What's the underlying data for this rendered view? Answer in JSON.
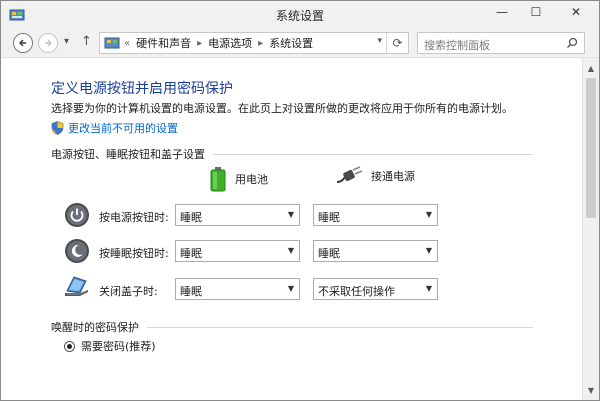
{
  "window": {
    "title": "系统设置",
    "controls": {
      "minimize": "—",
      "maximize": "☐",
      "close": "✕"
    }
  },
  "nav": {
    "back_icon": "back-arrow-icon",
    "forward_icon": "forward-arrow-icon",
    "recent_icon": "chevron-down-icon",
    "up_icon": "up-arrow-icon"
  },
  "address": {
    "overflow": "«",
    "crumbs": [
      "硬件和声音",
      "电源选项",
      "系统设置"
    ],
    "refresh_icon": "refresh-icon"
  },
  "search": {
    "placeholder": "搜索控制面板"
  },
  "page": {
    "title": "定义电源按钮并启用密码保护",
    "description": "选择要为你的计算机设置的电源设置。在此页上对设置所做的更改将应用于你所有的电源计划。",
    "change_link": "更改当前不可用的设置"
  },
  "section_power": {
    "heading": "电源按钮、睡眠按钮和盖子设置",
    "columns": {
      "battery": "用电池",
      "plugged": "接通电源"
    },
    "rows": [
      {
        "label": "按电源按钮时:",
        "battery": "睡眠",
        "plugged": "睡眠",
        "icon": "power-button-icon"
      },
      {
        "label": "按睡眠按钮时:",
        "battery": "睡眠",
        "plugged": "睡眠",
        "icon": "sleep-button-icon"
      },
      {
        "label": "关闭盖子时:",
        "battery": "睡眠",
        "plugged": "不采取任何操作",
        "icon": "laptop-lid-icon"
      }
    ]
  },
  "section_password": {
    "heading": "唤醒时的密码保护",
    "option_required": "需要密码(推荐)"
  },
  "colors": {
    "title_blue": "#1c3f95",
    "link_blue": "#0066cc",
    "battery_green": "#3fae2a"
  }
}
